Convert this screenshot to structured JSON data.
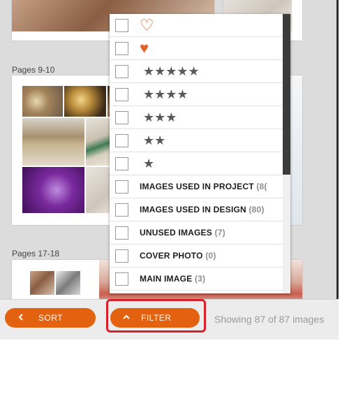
{
  "spreads": [
    {
      "label": "Pages 9-10"
    },
    {
      "label": "Pages 17-18"
    }
  ],
  "filter_menu": {
    "rows": [
      {
        "kind": "heart-outline",
        "icon": "heart-outline-icon",
        "glyph": "♡"
      },
      {
        "kind": "heart-filled",
        "icon": "heart-filled-icon",
        "glyph": "♥"
      },
      {
        "kind": "stars",
        "stars": "★★★★★",
        "count": 5
      },
      {
        "kind": "stars",
        "stars": "★★★★",
        "count": 4
      },
      {
        "kind": "stars",
        "stars": "★★★",
        "count": 3
      },
      {
        "kind": "stars",
        "stars": "★★",
        "count": 2
      },
      {
        "kind": "stars",
        "stars": "★",
        "count": 1
      },
      {
        "kind": "label",
        "label": "IMAGES USED IN PROJECT",
        "count_text": "(8("
      },
      {
        "kind": "label",
        "label": "IMAGES USED IN DESIGN",
        "count_text": "(80)"
      },
      {
        "kind": "label",
        "label": "UNUSED IMAGES",
        "count_text": "(7)"
      },
      {
        "kind": "label",
        "label": "COVER PHOTO",
        "count_text": "(0)"
      },
      {
        "kind": "label",
        "label": "MAIN IMAGE",
        "count_text": "(3)"
      }
    ]
  },
  "toolbar": {
    "sort_label": "SORT",
    "filter_label": "FILTER",
    "status": "Showing 87 of 87 images"
  },
  "colors": {
    "accent": "#e2620f",
    "highlight": "#d6202a",
    "heart": "#e0622a"
  }
}
